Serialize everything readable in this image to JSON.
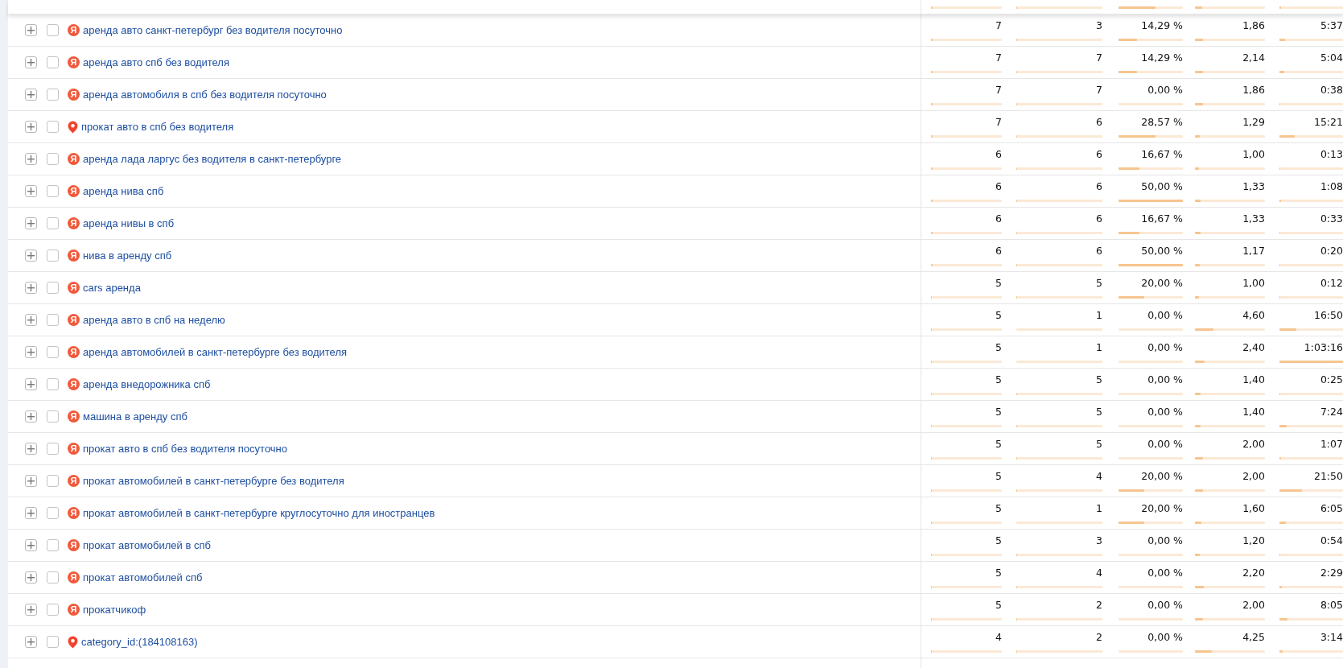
{
  "top_partial_row": {
    "cells": [
      {
        "level": 0.02
      },
      {
        "level": 0.01
      },
      {
        "level": 0.57
      },
      {
        "level": 0.1
      },
      {
        "level": 0.03
      }
    ]
  },
  "rows": [
    {
      "query": "аренда авто санкт-петербург без водителя посуточно",
      "source": {
        "kind": "search",
        "label": "Я"
      },
      "expanded": false,
      "checked": false,
      "cells": [
        {
          "text": "7",
          "level": 0.02
        },
        {
          "text": "3",
          "level": 0.01
        },
        {
          "text": "14,29 %",
          "level": 0.29
        },
        {
          "text": "1,86",
          "level": 0.11
        },
        {
          "text": "5:37",
          "level": 0.09
        }
      ]
    },
    {
      "query": "аренда авто спб без водителя",
      "source": {
        "kind": "search",
        "label": "Я"
      },
      "expanded": false,
      "checked": false,
      "cells": [
        {
          "text": "7",
          "level": 0.02
        },
        {
          "text": "7",
          "level": 0.01
        },
        {
          "text": "14,29 %",
          "level": 0.29
        },
        {
          "text": "2,14",
          "level": 0.12
        },
        {
          "text": "5:04",
          "level": 0.08
        }
      ]
    },
    {
      "query": "аренда автомобиля в спб без водителя посуточно",
      "source": {
        "kind": "search",
        "label": "Я"
      },
      "expanded": false,
      "checked": false,
      "cells": [
        {
          "text": "7",
          "level": 0.02
        },
        {
          "text": "7",
          "level": 0.01
        },
        {
          "text": "0,00 %",
          "level": 0
        },
        {
          "text": "1,86",
          "level": 0.11
        },
        {
          "text": "0:38",
          "level": 0.01
        }
      ]
    },
    {
      "query": "прокат авто в спб без водителя",
      "source": {
        "kind": "maps"
      },
      "expanded": false,
      "checked": false,
      "cells": [
        {
          "text": "7",
          "level": 0.02
        },
        {
          "text": "6",
          "level": 0.01
        },
        {
          "text": "28,57 %",
          "level": 0.57
        },
        {
          "text": "1,29",
          "level": 0.07
        },
        {
          "text": "15:21",
          "level": 0.24
        }
      ]
    },
    {
      "query": "аренда лада ларгус без водителя в санкт-петербурге",
      "source": {
        "kind": "search",
        "label": "Я"
      },
      "expanded": false,
      "checked": false,
      "cells": [
        {
          "text": "6",
          "level": 0.02
        },
        {
          "text": "6",
          "level": 0.01
        },
        {
          "text": "16,67 %",
          "level": 0.33
        },
        {
          "text": "1,00",
          "level": 0.06
        },
        {
          "text": "0:13",
          "level": 0.01
        }
      ]
    },
    {
      "query": "аренда нива спб",
      "source": {
        "kind": "search",
        "label": "Я"
      },
      "expanded": false,
      "checked": false,
      "cells": [
        {
          "text": "6",
          "level": 0.02
        },
        {
          "text": "6",
          "level": 0.01
        },
        {
          "text": "50,00 %",
          "level": 1
        },
        {
          "text": "1,33",
          "level": 0.08
        },
        {
          "text": "1:08",
          "level": 0.02
        }
      ]
    },
    {
      "query": "аренда нивы в спб",
      "source": {
        "kind": "search",
        "label": "Я"
      },
      "expanded": false,
      "checked": false,
      "cells": [
        {
          "text": "6",
          "level": 0.02
        },
        {
          "text": "6",
          "level": 0.01
        },
        {
          "text": "16,67 %",
          "level": 0.33
        },
        {
          "text": "1,33",
          "level": 0.08
        },
        {
          "text": "0:33",
          "level": 0.01
        }
      ]
    },
    {
      "query": "нива в аренду спб",
      "source": {
        "kind": "search",
        "label": "Я"
      },
      "expanded": false,
      "checked": false,
      "cells": [
        {
          "text": "6",
          "level": 0.02
        },
        {
          "text": "6",
          "level": 0.01
        },
        {
          "text": "50,00 %",
          "level": 1
        },
        {
          "text": "1,17",
          "level": 0.07
        },
        {
          "text": "0:20",
          "level": 0.01
        }
      ]
    },
    {
      "query": "cars аренда",
      "source": {
        "kind": "search",
        "label": "Я"
      },
      "expanded": false,
      "checked": false,
      "cells": [
        {
          "text": "5",
          "level": 0.015
        },
        {
          "text": "5",
          "level": 0.01
        },
        {
          "text": "20,00 %",
          "level": 0.4
        },
        {
          "text": "1,00",
          "level": 0.06
        },
        {
          "text": "0:12",
          "level": 0.01
        }
      ]
    },
    {
      "query": "аренда авто в спб на неделю",
      "source": {
        "kind": "search",
        "label": "Я"
      },
      "expanded": false,
      "checked": false,
      "cells": [
        {
          "text": "5",
          "level": 0.015
        },
        {
          "text": "1",
          "level": 0
        },
        {
          "text": "0,00 %",
          "level": 0
        },
        {
          "text": "4,60",
          "level": 0.26
        },
        {
          "text": "16:50",
          "level": 0.27
        }
      ]
    },
    {
      "query": "аренда автомобилей в санкт-петербурге без водителя",
      "source": {
        "kind": "search",
        "label": "Я"
      },
      "expanded": false,
      "checked": false,
      "cells": [
        {
          "text": "5",
          "level": 0.015
        },
        {
          "text": "1",
          "level": 0
        },
        {
          "text": "0,00 %",
          "level": 0
        },
        {
          "text": "2,40",
          "level": 0.14
        },
        {
          "text": "1:03:16",
          "level": 1
        }
      ]
    },
    {
      "query": "аренда внедорожника спб",
      "source": {
        "kind": "search",
        "label": "Я"
      },
      "expanded": false,
      "checked": false,
      "cells": [
        {
          "text": "5",
          "level": 0.015
        },
        {
          "text": "5",
          "level": 0.01
        },
        {
          "text": "0,00 %",
          "level": 0
        },
        {
          "text": "1,40",
          "level": 0.08
        },
        {
          "text": "0:25",
          "level": 0.01
        }
      ]
    },
    {
      "query": "машина в аренду спб",
      "source": {
        "kind": "search",
        "label": "Я"
      },
      "expanded": false,
      "checked": false,
      "cells": [
        {
          "text": "5",
          "level": 0.015
        },
        {
          "text": "5",
          "level": 0.01
        },
        {
          "text": "0,00 %",
          "level": 0
        },
        {
          "text": "1,40",
          "level": 0.08
        },
        {
          "text": "7:24",
          "level": 0.12
        }
      ]
    },
    {
      "query": "прокат авто в спб без водителя посуточно",
      "source": {
        "kind": "search",
        "label": "Я"
      },
      "expanded": false,
      "checked": false,
      "cells": [
        {
          "text": "5",
          "level": 0.015
        },
        {
          "text": "5",
          "level": 0.01
        },
        {
          "text": "0,00 %",
          "level": 0
        },
        {
          "text": "2,00",
          "level": 0.11
        },
        {
          "text": "1:07",
          "level": 0.02
        }
      ]
    },
    {
      "query": "прокат автомобилей в санкт-петербурге без водителя",
      "source": {
        "kind": "search",
        "label": "Я"
      },
      "expanded": false,
      "checked": false,
      "cells": [
        {
          "text": "5",
          "level": 0.015
        },
        {
          "text": "4",
          "level": 0.01
        },
        {
          "text": "20,00 %",
          "level": 0.4
        },
        {
          "text": "2,00",
          "level": 0.11
        },
        {
          "text": "21:50",
          "level": 0.35
        }
      ]
    },
    {
      "query": "прокат автомобилей в санкт-петербурге круглосуточно для иностранцев",
      "source": {
        "kind": "search",
        "label": "Я"
      },
      "expanded": false,
      "checked": false,
      "cells": [
        {
          "text": "5",
          "level": 0.015
        },
        {
          "text": "1",
          "level": 0
        },
        {
          "text": "20,00 %",
          "level": 0.4
        },
        {
          "text": "1,60",
          "level": 0.09
        },
        {
          "text": "6:05",
          "level": 0.1
        }
      ]
    },
    {
      "query": "прокат автомобилей в спб",
      "source": {
        "kind": "search",
        "label": "Я"
      },
      "expanded": false,
      "checked": false,
      "cells": [
        {
          "text": "5",
          "level": 0.015
        },
        {
          "text": "3",
          "level": 0.01
        },
        {
          "text": "0,00 %",
          "level": 0
        },
        {
          "text": "1,20",
          "level": 0.07
        },
        {
          "text": "0:54",
          "level": 0.01
        }
      ]
    },
    {
      "query": "прокат автомобилей спб",
      "source": {
        "kind": "search",
        "label": "Я"
      },
      "expanded": false,
      "checked": false,
      "cells": [
        {
          "text": "5",
          "level": 0.015
        },
        {
          "text": "4",
          "level": 0.01
        },
        {
          "text": "0,00 %",
          "level": 0
        },
        {
          "text": "2,20",
          "level": 0.13
        },
        {
          "text": "2:29",
          "level": 0.04
        }
      ]
    },
    {
      "query": "прокатчикоф",
      "source": {
        "kind": "search",
        "label": "Я"
      },
      "expanded": false,
      "checked": false,
      "cells": [
        {
          "text": "5",
          "level": 0.015
        },
        {
          "text": "2",
          "level": 0.01
        },
        {
          "text": "0,00 %",
          "level": 0
        },
        {
          "text": "2,00",
          "level": 0.11
        },
        {
          "text": "8:05",
          "level": 0.13
        }
      ]
    },
    {
      "query": "category_id:(184108163)",
      "source": {
        "kind": "maps"
      },
      "expanded": false,
      "checked": false,
      "cells": [
        {
          "text": "4",
          "level": 0.01
        },
        {
          "text": "2",
          "level": 0.01
        },
        {
          "text": "0,00 %",
          "level": 0
        },
        {
          "text": "4,25",
          "level": 0.24
        },
        {
          "text": "3:14",
          "level": 0.05
        }
      ]
    }
  ]
}
